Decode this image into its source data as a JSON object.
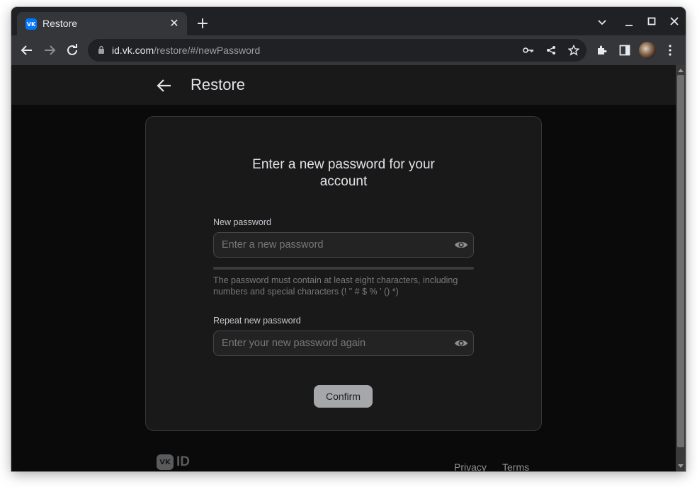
{
  "browser": {
    "tab_title": "Restore",
    "favicon_text": "VK",
    "url_host": "id.vk.com",
    "url_path": "/restore/#/newPassword"
  },
  "header": {
    "title": "Restore"
  },
  "form": {
    "heading": "Enter a new password for your account",
    "new_password_label": "New password",
    "new_password_placeholder": "Enter a new password",
    "hint": "The password must contain at least eight characters, including numbers and special characters (! \" # $ % ' () *)",
    "repeat_label": "Repeat new password",
    "repeat_placeholder": "Enter your new password again",
    "confirm_label": "Confirm",
    "strength_fraction": 0
  },
  "footer": {
    "logo_mark": "VK",
    "logo_text": "ID",
    "privacy": "Privacy",
    "terms": "Terms"
  },
  "icons": {
    "tab_close": "close-icon",
    "new_tab": "plus-icon",
    "back": "arrow-left-icon",
    "forward": "arrow-right-icon",
    "reload": "reload-icon",
    "lock": "lock-icon",
    "key": "key-icon",
    "share": "share-icon",
    "bookmark": "star-icon",
    "extensions": "puzzle-icon",
    "side_panel": "side-panel-icon",
    "menu": "kebab-menu-icon",
    "show_password": "eye-icon"
  },
  "colors": {
    "accent": "#0077ff",
    "page_bg": "#0a0a0a",
    "card_bg": "#19191a",
    "button_bg": "#a5a7aa"
  }
}
